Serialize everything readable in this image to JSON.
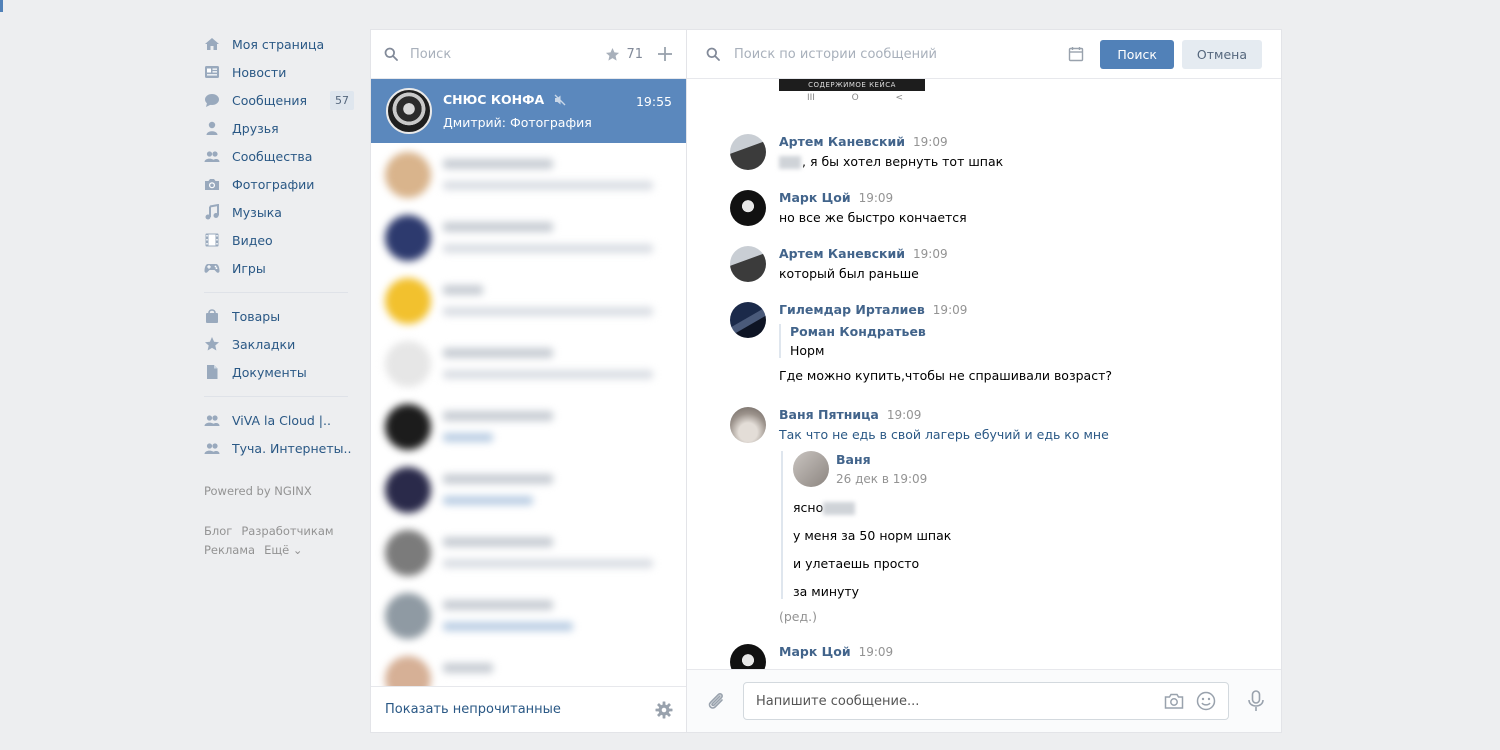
{
  "colors": {
    "accent": "#5181b8",
    "link": "#2a5885",
    "author": "#42648b",
    "active_dialog": "#5b88bd",
    "page_bg": "#edeef0"
  },
  "nav": {
    "items": [
      {
        "label": "Моя страница",
        "icon": "home-icon"
      },
      {
        "label": "Новости",
        "icon": "news-icon"
      },
      {
        "label": "Сообщения",
        "icon": "messages-icon",
        "badge": "57"
      },
      {
        "label": "Друзья",
        "icon": "friends-icon"
      },
      {
        "label": "Сообщества",
        "icon": "groups-icon"
      },
      {
        "label": "Фотографии",
        "icon": "camera-icon"
      },
      {
        "label": "Музыка",
        "icon": "music-icon"
      },
      {
        "label": "Видео",
        "icon": "video-icon"
      },
      {
        "label": "Игры",
        "icon": "gamepad-icon"
      },
      {
        "label": "Товары",
        "icon": "bag-icon"
      },
      {
        "label": "Закладки",
        "icon": "star-icon"
      },
      {
        "label": "Документы",
        "icon": "document-icon"
      },
      {
        "label": "ViVA la Cloud |..",
        "icon": "group-icon"
      },
      {
        "label": "Туча. Интернеты..",
        "icon": "group-icon"
      }
    ],
    "powered": "Powered by NGINX",
    "footer": {
      "blog": "Блог",
      "developers": "Разработчикам",
      "ads": "Реклама",
      "more": "Ещё ⌄"
    }
  },
  "dialogs": {
    "search_placeholder": "Поиск",
    "starred_count": "71",
    "active": {
      "name": "СНЮС КОНФА",
      "time": "19:55",
      "preview": "Дмитрий: Фотография",
      "muted": true
    },
    "show_unread": "Показать непрочитанные"
  },
  "chat": {
    "search_placeholder": "Поиск по истории сообщений",
    "search_button": "Поиск",
    "cancel_button": "Отмена",
    "image_caption": "СОДЕРЖИМОЕ КЕЙСА",
    "phone_nav": [
      "III",
      "O",
      "<"
    ],
    "messages": [
      {
        "author": "Артем Каневский",
        "time": "19:09",
        "text": ", я бы хотел вернуть тот шпак"
      },
      {
        "author": "Марк Цой",
        "time": "19:09",
        "text": "но все же быстро кончается"
      },
      {
        "author": "Артем Каневский",
        "time": "19:09",
        "text": "который был раньше"
      },
      {
        "author": "Гилемдар Ирталиев",
        "time": "19:09",
        "quote_author": "Роман Кондратьев",
        "quote_text": "Норм",
        "text": "Где можно купить,чтобы не спрашивали возраст?"
      },
      {
        "author": "Ваня Пятница",
        "time": "19:09",
        "text": "Так что не едь в свой лагерь ебучий и едь ко мне",
        "forwarded": {
          "author": "Ваня",
          "date": "26 дек в 19:09",
          "lines": [
            "ясно",
            "у меня за 50 норм шпак",
            "и улетаешь просто",
            "за минуту"
          ]
        },
        "edited": "(ред.)"
      },
      {
        "author": "Марк Цой",
        "time": "19:09"
      }
    ],
    "composer_placeholder": "Напишите сообщение..."
  }
}
